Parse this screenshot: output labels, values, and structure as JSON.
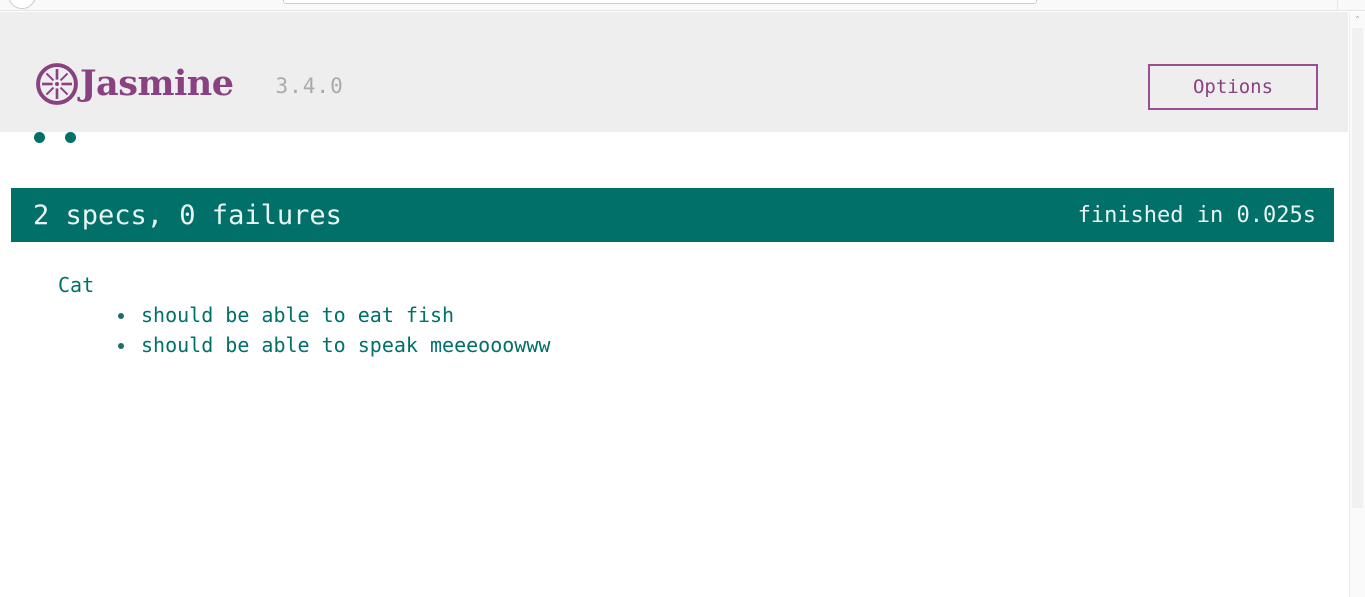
{
  "browser": {
    "back_button_icon": "circle-button",
    "address_bar_value": "",
    "address_bar_placeholder": ""
  },
  "scrollbar": {
    "up_arrow_glyph": "˄"
  },
  "reporter": {
    "banner": {
      "logo_icon": "jasmine-flower-icon",
      "brand_name": "Jasmine",
      "version": "3.4.0",
      "options_label": "Options"
    },
    "symbol_summary": [
      {
        "name": "spec-symbol-passed",
        "status": "passed"
      },
      {
        "name": "spec-symbol-passed",
        "status": "passed"
      }
    ],
    "alert": {
      "counts": "2 specs, 0 failures",
      "duration": "finished in 0.025s",
      "background_color": "#007069",
      "text_color": "#e9f5f4"
    },
    "results": {
      "suites": [
        {
          "name": "Cat",
          "specs": [
            "should be able to eat fish",
            "should be able to speak meeeooowww"
          ]
        }
      ]
    },
    "colors": {
      "brand_purple": "#8a4182",
      "pass_teal": "#007069",
      "page_gray": "#eeeeee",
      "version_gray": "#aaaaaa"
    }
  }
}
